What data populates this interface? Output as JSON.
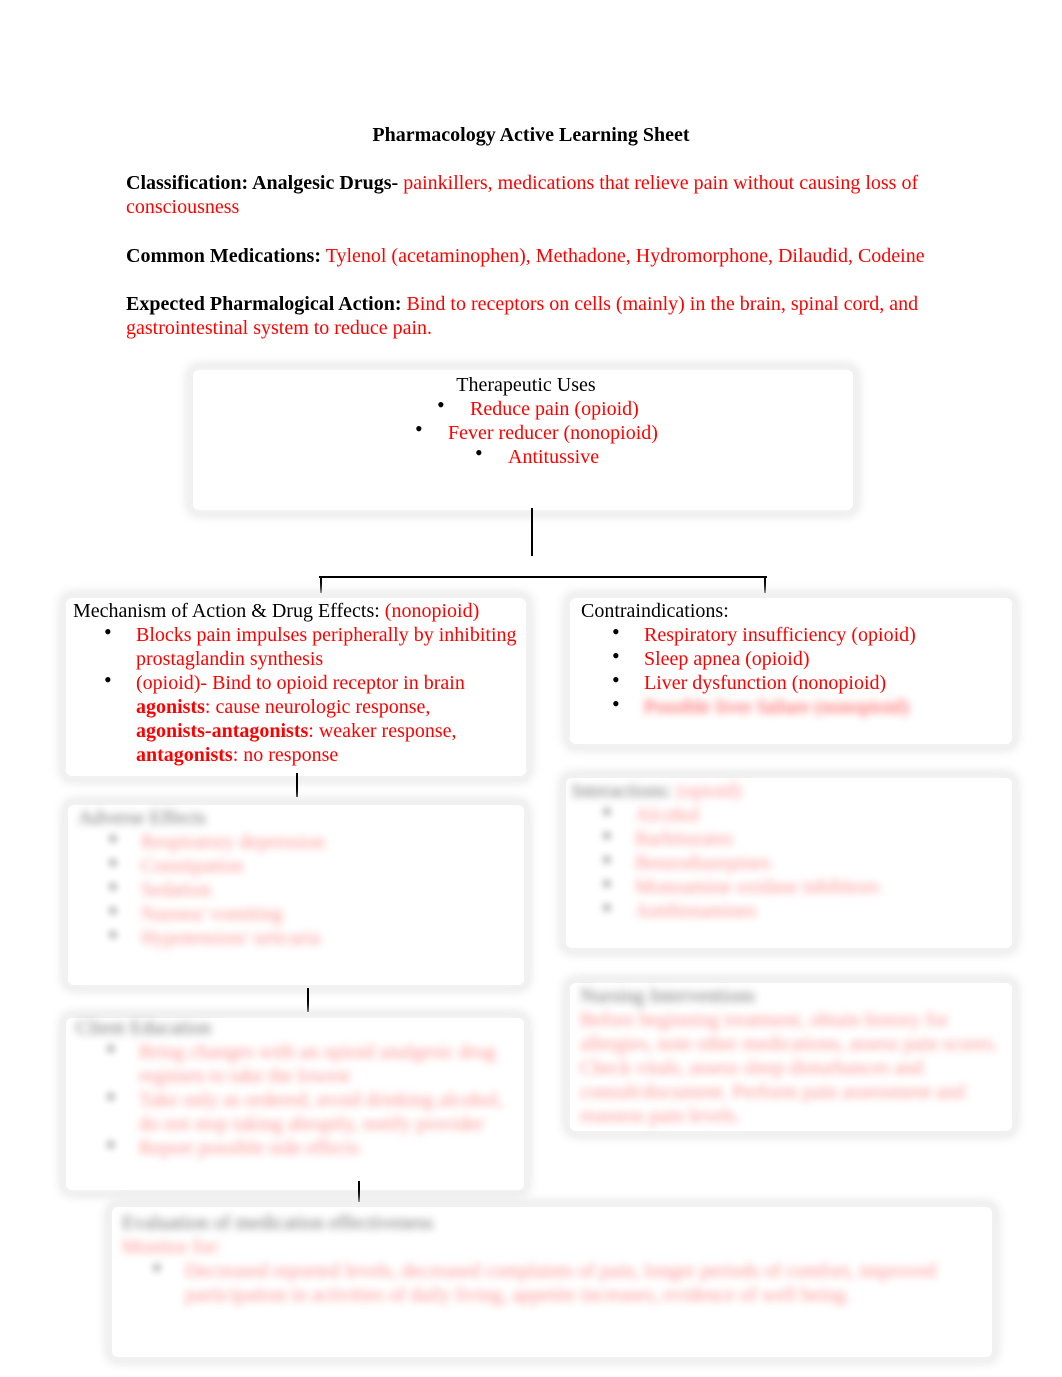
{
  "document": {
    "title": "Pharmacology Active Learning Sheet",
    "classification": {
      "label": "Classification: Analgesic Drugs-",
      "value": " painkillers, medications that relieve pain without causing loss of consciousness"
    },
    "common_medications": {
      "label": "Common Medications:",
      "value": " Tylenol (acetaminophen), Methadone, Hydromorphone, Dilaudid, Codeine"
    },
    "expected_action": {
      "label": "Expected Pharmalogical Action:",
      "value": " Bind to receptors on cells (mainly) in the brain, spinal cord, and gastrointestinal system to reduce pain."
    }
  },
  "therapeutic_uses": {
    "heading": "Therapeutic Uses",
    "items": [
      "Reduce pain (opioid)",
      "Fever reducer (nonopioid)",
      "Antitussive"
    ]
  },
  "mechanism": {
    "heading": "Mechanism of Action & Drug Effects:",
    "heading_note": " (nonopioid)",
    "item1": "Blocks pain impulses peripherally by inhibiting prostaglandin synthesis",
    "item2_intro": "(opioid)- Bind to opioid receptor in brain",
    "agonists_term": "agonists",
    "agonists_desc": ": cause neurologic response,",
    "mixed_term": "agonists-antagonists",
    "mixed_desc": ": weaker response,",
    "antagonists_term": "antagonists",
    "antagonists_desc": ": no response"
  },
  "contraindications": {
    "heading": "Contraindications:",
    "items": [
      "Respiratory insufficiency (opioid)",
      "Sleep apnea (opioid)",
      "Liver dysfunction (nonopioid)"
    ],
    "obscured_item": "Possible liver failure (nonopioid)"
  },
  "obscured_sections": {
    "adverse_effects": {
      "heading": "Adverse Effects",
      "items": [
        "Respiratory depression",
        "Constipation",
        "Sedation",
        "Nausea/ vomiting",
        "Hypotension/ urticaria"
      ]
    },
    "interactions": {
      "heading": "Interactions:",
      "heading_note": " (opioid)",
      "items": [
        "Alcohol",
        "Barbiturates",
        "Benzodiazepines",
        "Monoamine oxidase inhibitors",
        "Antihistamines"
      ]
    },
    "client_education": {
      "heading": "Client Education",
      "items": [
        "Bring changes with an opioid analgesic drug regimen to take the lowest",
        "Take only as ordered; avoid drinking alcohol, do not stop taking abruptly, notify provider",
        "Report possible side effects"
      ]
    },
    "nursing_interventions": {
      "heading": "Nursing Interventions",
      "text": "Before beginning treatment, obtain history for allergies, note other medications, assess pain scores. Check vitals, assess sleep disturbances and consult/document. Perform pain assessment and reassess pain levels."
    },
    "evaluation": {
      "heading": "Evaluation of medication effectiveness",
      "sub": "Monitor for:",
      "items": [
        "Decreased reported levels, decreased complaints of pain, longer periods of comfort, improved participation in activities of daily living, appetite increases, evidence of well being."
      ]
    }
  }
}
